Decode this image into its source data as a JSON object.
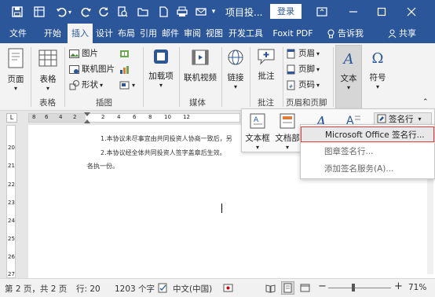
{
  "titlebar": {
    "doc_title": "项目投...",
    "login": "登录"
  },
  "tabs": [
    "文件",
    "开始",
    "插入",
    "设计",
    "布局",
    "引用",
    "邮件",
    "审阅",
    "视图",
    "开发工具",
    "Foxit PDF",
    "告诉我",
    "共享"
  ],
  "ribbon": {
    "page": "页面",
    "table": "表格",
    "table_group": "表格",
    "picture": "图片",
    "online_picture": "联机图片",
    "shapes": "形状",
    "illustrations_group": "插图",
    "addins": "加载项",
    "online_video": "联机视频",
    "media_group": "媒体",
    "link": "链接",
    "comment": "批注",
    "comment_group": "批注",
    "header": "页眉",
    "footer": "页脚",
    "page_number": "页码",
    "header_footer_group": "页眉和页脚",
    "text": "文本",
    "symbol": "符号"
  },
  "textpanel": {
    "textbox": "文本框",
    "docparts": "文档部",
    "signature_line": "签名行"
  },
  "signature_menu": {
    "items": [
      "Microsoft Office 签名行...",
      "图章签名行...",
      "添加签名服务(A)..."
    ]
  },
  "document": {
    "line1": "1.本协议未尽事宜由共同投资人协商一致后，另",
    "line2": "2.本协议经全体共同投资人签字盖章后生效。",
    "line3": "各执一份。"
  },
  "ruler_numbers": [
    "8",
    "6",
    "4",
    "2",
    "2",
    "4",
    "6",
    "8",
    "10",
    "12"
  ],
  "vruler_numbers": [
    "20",
    "21",
    "22",
    "23",
    "24",
    "25",
    "26",
    "27"
  ],
  "statusbar": {
    "page": "第 2 页，共 2 页",
    "row": "行: 20",
    "words": "1203 个字",
    "lang": "中文(中国)",
    "zoom": "71%"
  },
  "colors": {
    "brand": "#2b579a",
    "highlight_border": "#e53935"
  }
}
